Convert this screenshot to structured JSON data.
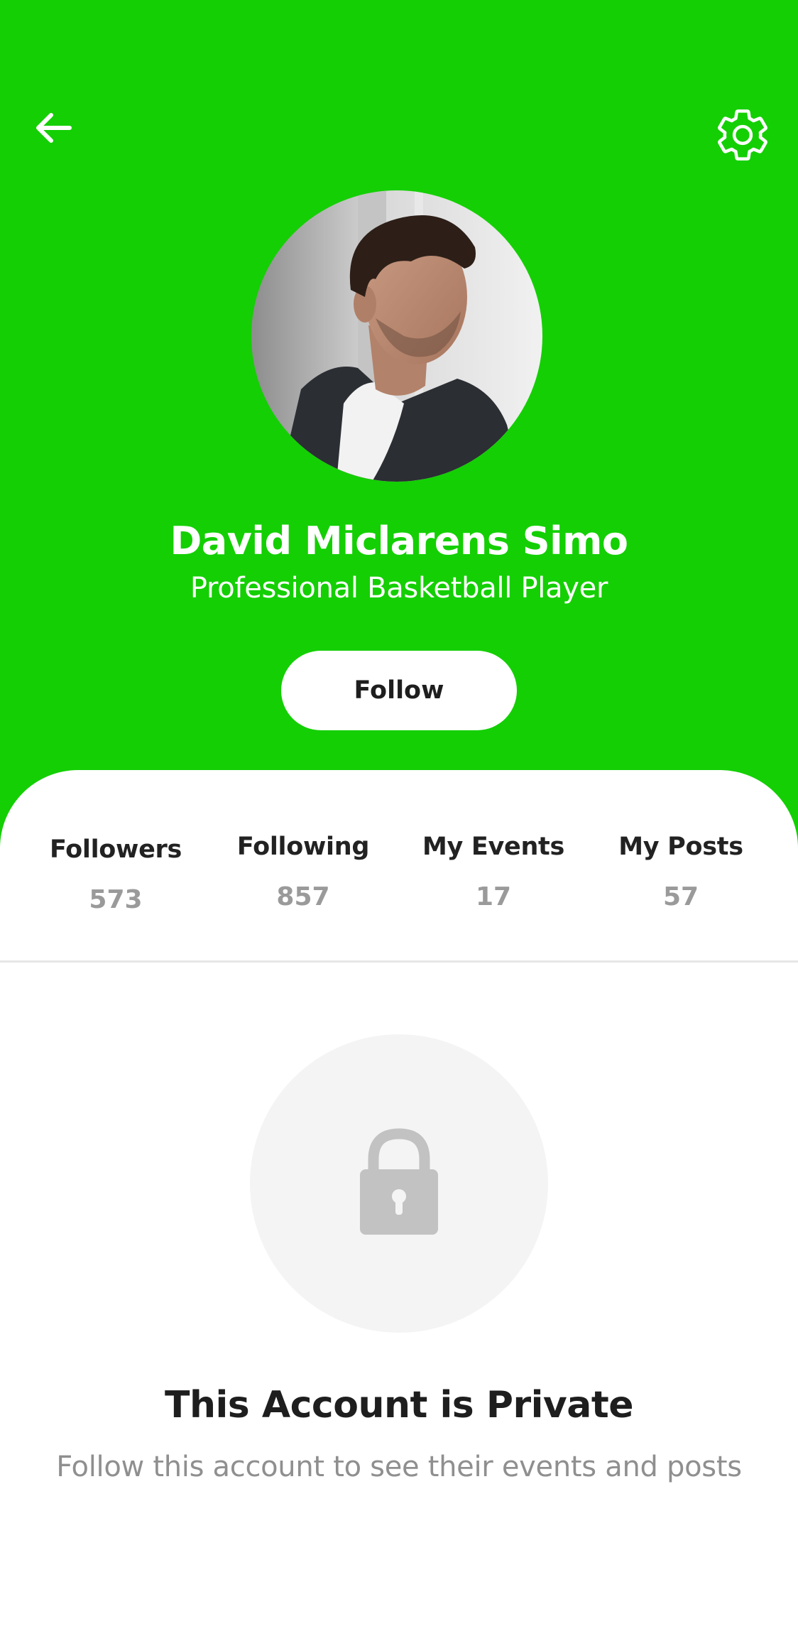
{
  "header": {
    "back_icon": "arrow-left-icon",
    "settings_icon": "gear-icon",
    "background_color": "#14cf04"
  },
  "profile": {
    "name": "David Miclarens Simo",
    "title": "Professional Basketball Player",
    "follow_label": "Follow"
  },
  "stats": [
    {
      "label": "Followers",
      "value": "573"
    },
    {
      "label": "Following",
      "value": "857"
    },
    {
      "label": "My Events",
      "value": "17"
    },
    {
      "label": "My Posts",
      "value": "57"
    }
  ],
  "private_notice": {
    "icon": "lock-icon",
    "title": "This Account is Private",
    "description": "Follow this account to see their events and posts"
  }
}
